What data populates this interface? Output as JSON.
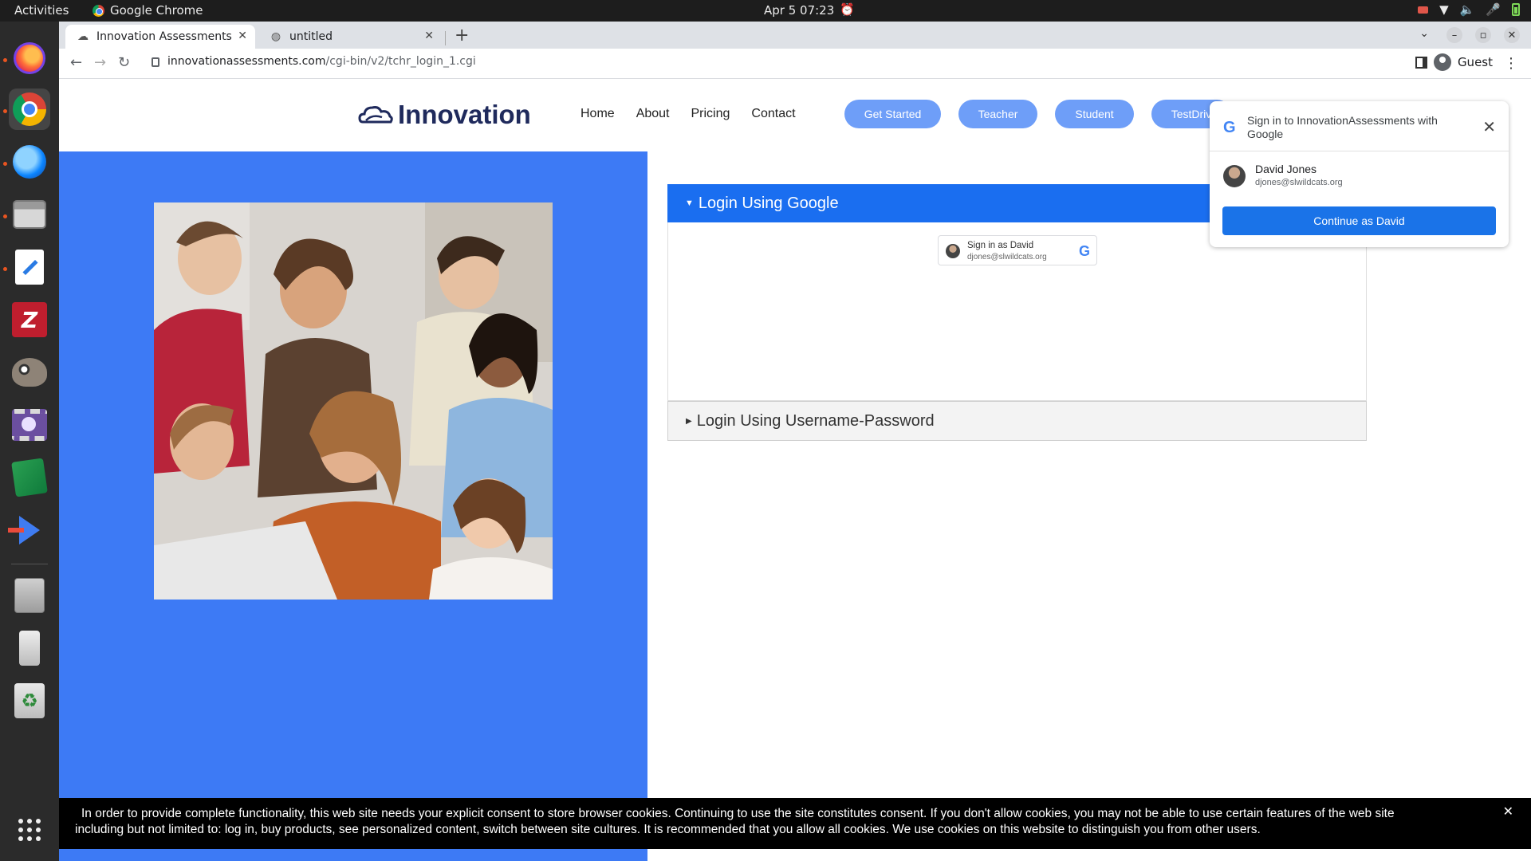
{
  "os": {
    "activities": "Activities",
    "app_name": "Google Chrome",
    "clock": "Apr 5  07:23"
  },
  "browser": {
    "tabs": [
      {
        "title": "Innovation Assessments",
        "active": true
      },
      {
        "title": "untitled",
        "active": false
      }
    ],
    "url_host": "innovationassessments.com",
    "url_path": "/cgi-bin/v2/tchr_login_1.cgi",
    "profile": "Guest"
  },
  "site": {
    "logo_text": "Innovation",
    "nav": [
      "Home",
      "About",
      "Pricing",
      "Contact"
    ],
    "buttons": {
      "get_started": "Get Started",
      "teacher": "Teacher",
      "student": "Student",
      "testdrive": "TestDriv"
    },
    "accordion": {
      "google_label": "Login Using Google",
      "password_label": "Login Using Username-Password"
    },
    "gsi_button": {
      "name": "Sign in as David",
      "email": "djones@slwildcats.org"
    }
  },
  "onetap": {
    "title": "Sign in to InnovationAssessments with Google",
    "user_name": "David Jones",
    "user_email": "djones@slwildcats.org",
    "continue_label": "Continue as David"
  },
  "cookie_banner": {
    "line1": "In order to provide complete functionality, this web site needs your explicit consent to store browser cookies. Continuing to use the site constitutes consent. If you don't allow cookies, you may not be able to use certain features of the web site",
    "line2": "including but not limited to: log in, buy products, see personalized content, switch between site cultures. It is recommended that you allow all cookies. We use cookies on this website to distinguish you from other users."
  },
  "colors": {
    "panel_blue": "#3d7af5",
    "accordion_active": "#1a6ef0",
    "pill_button": "#6e9ef8",
    "google_blue": "#1a73e8"
  }
}
